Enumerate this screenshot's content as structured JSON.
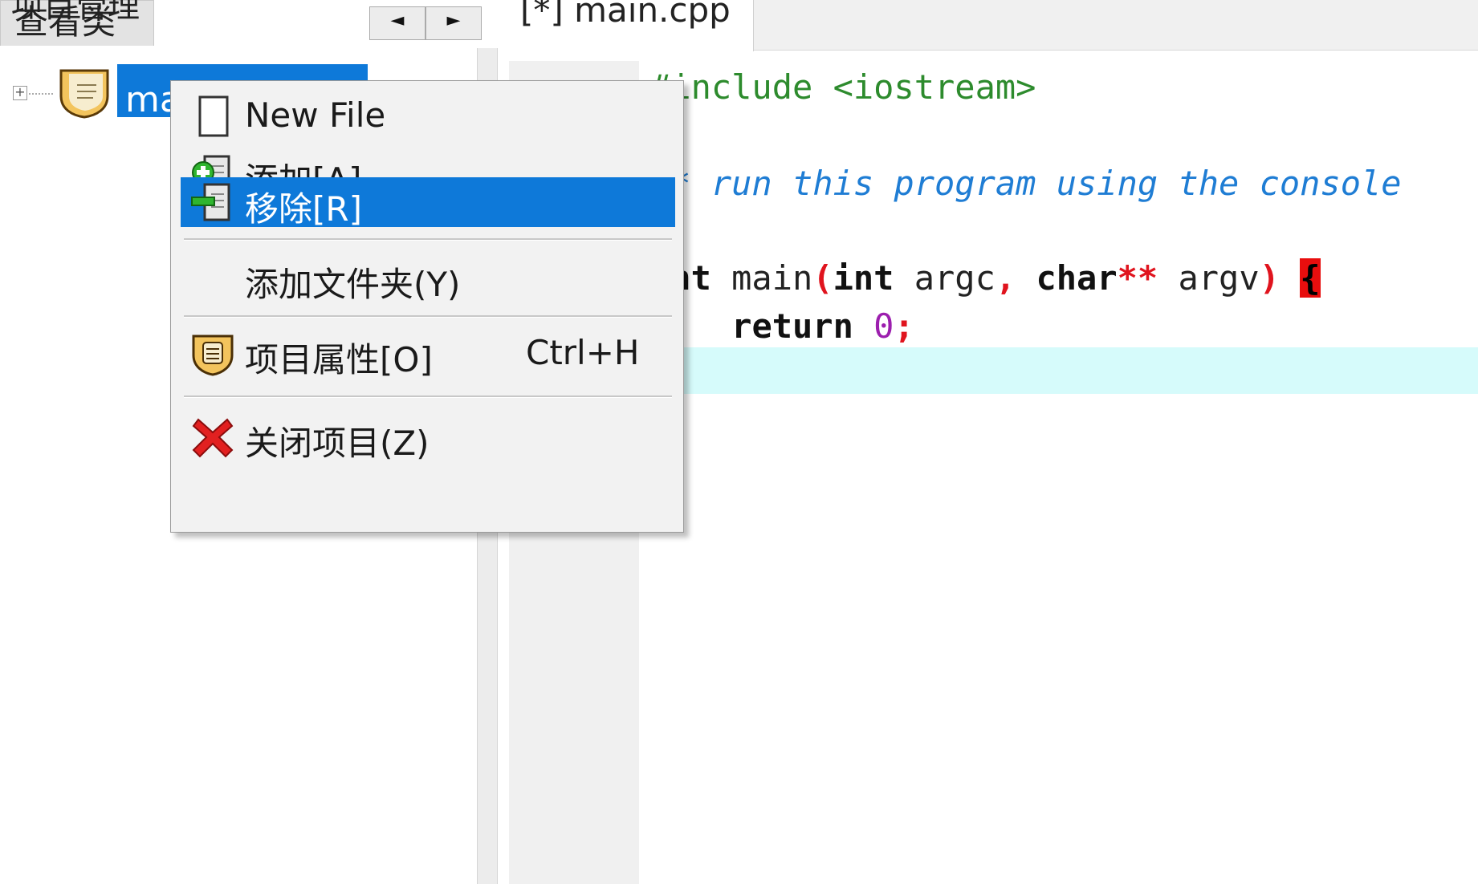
{
  "left_panel": {
    "tab_project": "项目管理",
    "tab_classes": "查看类",
    "nav_left": "◄",
    "nav_right": "►",
    "tree_expander": "+",
    "project_label": "main-无参函数"
  },
  "editor": {
    "tab_label": "[*] main.cpp",
    "code": {
      "include": "#include <iostream>",
      "comment": "/* run this program using the console",
      "main_kw1": "int",
      "main_name": " main",
      "main_paren_open": "(",
      "main_kw2": "int",
      "main_arg1": " argc",
      "main_comma": ",",
      "main_kw3": " char",
      "main_ptr": "**",
      "main_arg2": " argv",
      "main_paren_close": ")",
      "main_brace": "{",
      "return_kw": "return",
      "return_num": "0",
      "return_semi": ";"
    }
  },
  "context_menu": {
    "items": [
      {
        "label": "New File",
        "icon": "new-file-icon"
      },
      {
        "label": "添加[A]",
        "icon": "add-file-icon"
      },
      {
        "label": "移除[R]",
        "icon": "remove-file-icon",
        "selected": true
      },
      {
        "label": "添加文件夹(Y)",
        "icon": ""
      },
      {
        "label": "项目属性[O]",
        "icon": "project-properties-icon",
        "shortcut": "Ctrl+H"
      },
      {
        "label": "关闭项目(Z)",
        "icon": "close-project-icon"
      }
    ]
  },
  "colors": {
    "selection": "#0e79d9",
    "current_line": "#d6fbfb",
    "include": "#2d8b2d",
    "comment": "#1f7dd4",
    "operator": "#e0141e",
    "number": "#9c1fae"
  }
}
